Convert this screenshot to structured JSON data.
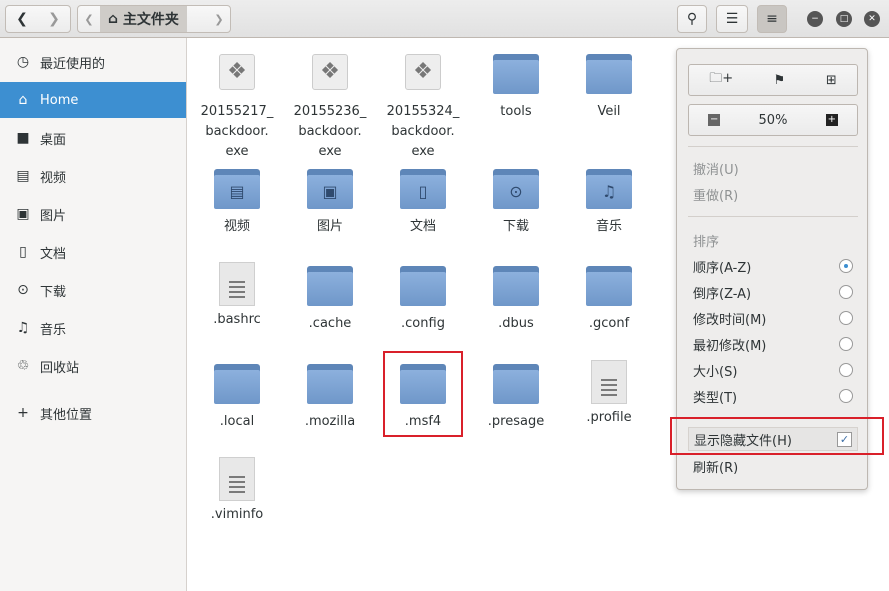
{
  "header": {
    "back_icon": "chevron-left",
    "forward_icon": "chevron-right",
    "path_label": "主文件夹",
    "path_icon": "home-icon",
    "search_icon": "search",
    "view_icon": "list-view",
    "menu_icon": "hamburger"
  },
  "sidebar": {
    "items": [
      {
        "label": "最近使用的",
        "icon": "◷"
      },
      {
        "label": "Home",
        "icon": "⌂",
        "selected": true
      },
      {
        "label": "桌面",
        "icon": "■"
      },
      {
        "label": "视频",
        "icon": "▤"
      },
      {
        "label": "图片",
        "icon": "▣"
      },
      {
        "label": "文档",
        "icon": "▯"
      },
      {
        "label": "下载",
        "icon": "⊙"
      },
      {
        "label": "音乐",
        "icon": "♫"
      },
      {
        "label": "回收站",
        "icon": "♲"
      },
      {
        "label": "其他位置",
        "icon": "+"
      }
    ]
  },
  "files": [
    {
      "name": "20155217_ backdoor. exe",
      "type": "exe"
    },
    {
      "name": "20155236_ backdoor. exe",
      "type": "exe"
    },
    {
      "name": "20155324_ backdoor. exe",
      "type": "exe"
    },
    {
      "name": "tools",
      "type": "folder"
    },
    {
      "name": "Veil",
      "type": "folder"
    },
    {
      "name": "视频",
      "type": "folder",
      "glyph": "▤"
    },
    {
      "name": "图片",
      "type": "folder",
      "glyph": "▣"
    },
    {
      "name": "文档",
      "type": "folder",
      "glyph": "▯"
    },
    {
      "name": "下载",
      "type": "folder",
      "glyph": "⊙"
    },
    {
      "name": "音乐",
      "type": "folder",
      "glyph": "♫"
    },
    {
      "name": ".bashrc",
      "type": "doc"
    },
    {
      "name": ".cache",
      "type": "folder"
    },
    {
      "name": ".config",
      "type": "folder"
    },
    {
      "name": ".dbus",
      "type": "folder"
    },
    {
      "name": ".gconf",
      "type": "folder"
    },
    {
      "name": ".local",
      "type": "folder"
    },
    {
      "name": ".mozilla",
      "type": "folder"
    },
    {
      "name": ".msf4",
      "type": "folder",
      "highlighted": true
    },
    {
      "name": ".presage",
      "type": "folder"
    },
    {
      "name": ".profile",
      "type": "doc"
    },
    {
      "name": ".viminfo",
      "type": "doc"
    }
  ],
  "menu": {
    "zoom": "50%",
    "undo": "撤消(U)",
    "redo": "重做(R)",
    "sort_heading": "排序",
    "sort_options": [
      {
        "label": "顺序(A-Z)",
        "selected": true
      },
      {
        "label": "倒序(Z-A)"
      },
      {
        "label": "修改时间(M)"
      },
      {
        "label": "最初修改(M)"
      },
      {
        "label": "大小(S)"
      },
      {
        "label": "类型(T)"
      }
    ],
    "show_hidden": "显示隐藏文件(H)",
    "show_hidden_checked": true,
    "refresh": "刷新(R)"
  },
  "colors": {
    "accent": "#3d8fd1",
    "highlight_box": "#d9202a",
    "folder": "#7aa0d0"
  }
}
